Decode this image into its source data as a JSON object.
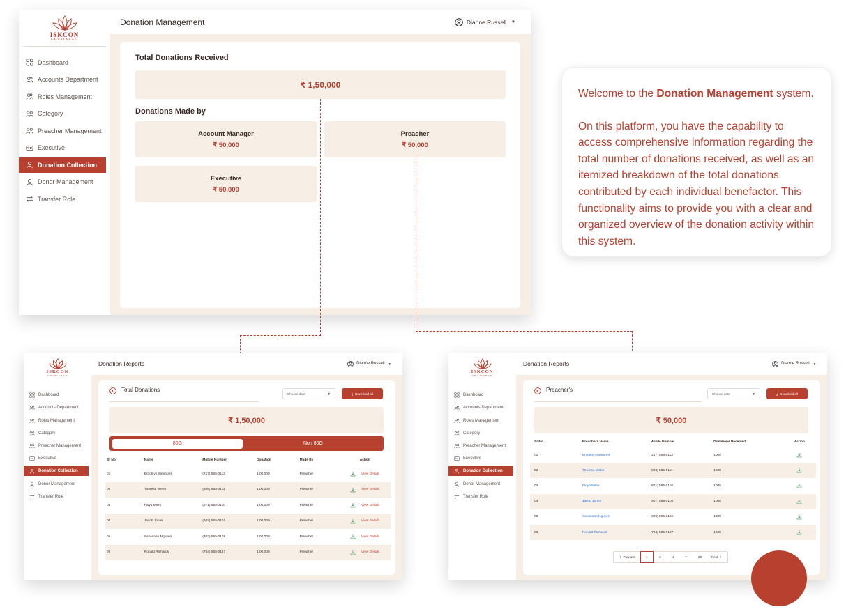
{
  "brand": {
    "name": "ISKCON",
    "location": "GHAZIABAD"
  },
  "colors": {
    "accent": "#b8402f",
    "panel": "#f7efe6",
    "link": "#2a6fd6"
  },
  "nav": [
    {
      "label": "Dashboard",
      "icon": "grid-icon"
    },
    {
      "label": "Accounts Department",
      "icon": "users-icon"
    },
    {
      "label": "Roles Management",
      "icon": "users-icon"
    },
    {
      "label": "Category",
      "icon": "user-group-icon"
    },
    {
      "label": "Preacher Management",
      "icon": "user-group-icon"
    },
    {
      "label": "Executive",
      "icon": "id-card-icon"
    },
    {
      "label": "Donation Collection",
      "icon": "user-icon",
      "active": true
    },
    {
      "label": "Donor Management",
      "icon": "user-icon"
    },
    {
      "label": "Transfer Role",
      "icon": "transfer-icon"
    }
  ],
  "main": {
    "header_title": "Donation Management",
    "user_name": "Dianne Russell",
    "total_heading": "Total Donations Received",
    "total_amount": "₹ 1,50,000",
    "made_by_heading": "Donations Made by",
    "breakdown": [
      {
        "label": "Account Manager",
        "amount": "₹ 50,000"
      },
      {
        "label": "Preacher",
        "amount": "₹ 50,000"
      },
      {
        "label": "Executive",
        "amount": "₹ 50,000"
      }
    ]
  },
  "tooltip": {
    "line1_pre": "Welcome to the ",
    "line1_bold": "Donation Management",
    "line1_post": " system.",
    "body": "On this platform, you have the capability to access comprehensive information regarding the total number of donations received, as well as an itemized breakdown of the total donations contributed by each individual benefactor. This functionality aims to provide you with a clear and organized overview of the donation activity within this system."
  },
  "report_left": {
    "header_title": "Donation Reports",
    "user_name": "Dianne Russell",
    "title": "Total Donations",
    "date_placeholder": "Choose date",
    "download_label": "Download all",
    "total_amount": "₹ 1,50,000",
    "tab_active": "80G",
    "tab_inactive": "Non 80G",
    "columns": [
      "Sr No.",
      "Name",
      "Mobile Number",
      "Donation",
      "Made By",
      "Action"
    ],
    "action_label": "View Details",
    "rows": [
      [
        "01",
        "Brooklyn Simmons",
        "(217) 555-0113",
        "1,00,000",
        "Preacher"
      ],
      [
        "02",
        "Theresa Webb",
        "(808) 555-0111",
        "1,00,000",
        "Preacher"
      ],
      [
        "03",
        "Floyd Miles",
        "(671) 555-0110",
        "1,00,000",
        "Preacher"
      ],
      [
        "04",
        "Jacob Jones",
        "(907) 555-0101",
        "1,00,000",
        "Preacher"
      ],
      [
        "05",
        "Savannah Nguyen",
        "(303) 555-0105",
        "1,00,000",
        "Preacher"
      ],
      [
        "06",
        "Ronald Richards",
        "(704) 555-0127",
        "1,00,000",
        "Preacher"
      ]
    ]
  },
  "report_right": {
    "header_title": "Donation Reports",
    "user_name": "Dianne Russell",
    "title": "Preacher's",
    "date_placeholder": "Choose date",
    "download_label": "Download all",
    "total_amount": "₹ 50,000",
    "columns": [
      "Sr No.",
      "Preachers Name",
      "Mobile Number",
      "Donations Received",
      "Action"
    ],
    "rows": [
      [
        "01",
        "Brooklyn Simmons",
        "(217) 555-0113",
        "1000"
      ],
      [
        "02",
        "Theresa Webb",
        "(808) 555-0111",
        "1000"
      ],
      [
        "03",
        "Floyd Miles",
        "(671) 555-0110",
        "1000"
      ],
      [
        "04",
        "Jacob Jones",
        "(907) 555-0101",
        "1000"
      ],
      [
        "05",
        "Savannah Nguyen",
        "(303) 555-0105",
        "1000"
      ],
      [
        "06",
        "Ronald Richards",
        "(704) 555-0127",
        "1000"
      ]
    ],
    "pagination": {
      "prev": "Previous",
      "pages": [
        "1",
        "2",
        "3",
        "•••",
        "30"
      ],
      "next": "Next",
      "current": "1"
    }
  }
}
